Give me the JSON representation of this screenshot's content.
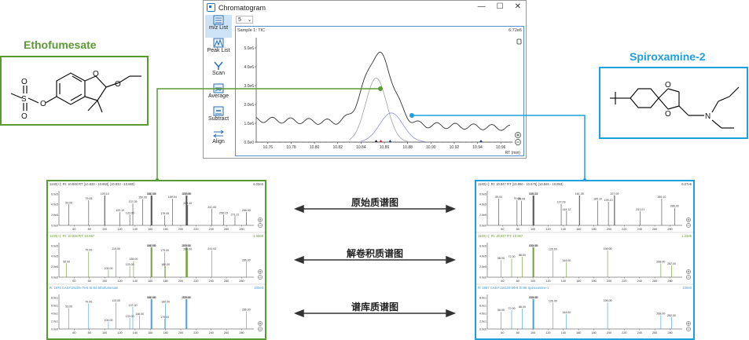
{
  "window": {
    "title": "Chromatogram",
    "controls": {
      "minimize": "—",
      "maximize": "☐",
      "close": "✕"
    },
    "selector_value": "5",
    "toolbar": [
      {
        "label": "m/z List",
        "icon": "mz-list-icon"
      },
      {
        "label": "Peak List",
        "icon": "peak-list-icon"
      },
      {
        "label": "Scan",
        "icon": "scan-icon"
      },
      {
        "label": "Average",
        "icon": "average-icon"
      },
      {
        "label": "Subtract",
        "icon": "subtract-icon"
      },
      {
        "label": "Align",
        "icon": "align-icon"
      }
    ],
    "plot_header_left": "Sample 1: TIC",
    "plot_header_right": "6.72e6",
    "xlabel": "RT (min)",
    "y_ticks": [
      "0.0e0",
      "1.0e6",
      "2.0e6",
      "3.0e6",
      "4.0e6",
      "5.0e6"
    ],
    "x_ticks": [
      "10.76",
      "10.78",
      "10.80",
      "10.82",
      "10.84",
      "10.86",
      "10.88",
      "10.90",
      "10.92",
      "10.94",
      "10.96"
    ]
  },
  "compounds": {
    "left_name": "Ethofumesate",
    "right_name": "Spiroxamine-2"
  },
  "labels": {
    "raw": "原始质谱图",
    "deconv": "解卷积质谱图",
    "library": "谱库质谱图"
  },
  "left_panels": [
    {
      "header": "1140(+): Rt: 10.848 RT [10.833 - 10.860] {10.833 - 10.860}",
      "max": "6.03e6",
      "color": "#444",
      "y_ticks": [
        "0.0e0",
        "2.0e5",
        "4.0e5",
        "6.0e5"
      ],
      "peaks": [
        [
          53.05,
          "53.05"
        ],
        [
          79.05,
          "79.05"
        ],
        [
          100.1,
          "100.10"
        ],
        [
          120.1,
          "120.10"
        ],
        [
          133.05,
          "133.05"
        ],
        [
          137.05,
          "137.05"
        ],
        [
          150.0,
          "150.00"
        ],
        [
          161.05,
          "161.05"
        ],
        [
          162.05,
          "162.05"
        ],
        [
          179.05,
          "179.05"
        ],
        [
          189.04,
          "189.04"
        ],
        [
          207.09,
          "207.09"
        ],
        [
          208.09,
          "208.09"
        ],
        [
          209.1,
          "209.10"
        ],
        [
          241.0,
          "241.00"
        ],
        [
          256.15,
          "256.15"
        ],
        [
          271.21,
          "271.21"
        ],
        [
          286.05,
          "286.05"
        ]
      ]
    },
    {
      "header": "1140(+): Rt: 10.848 RT: 10.867",
      "max": "1.63e6",
      "color": "#6a9a2f",
      "y_ticks": [
        "0.0e0",
        "2.0e5",
        "4.0e5",
        "6.0e5"
      ],
      "peaks": [
        [
          50.0,
          "50.00"
        ],
        [
          79.0,
          "79.00"
        ],
        [
          105.0,
          "105.00"
        ],
        [
          115.0,
          "115.00"
        ],
        [
          133.0,
          "133.00"
        ],
        [
          138.0,
          "138.00"
        ],
        [
          161.0,
          "161.00"
        ],
        [
          162.0,
          "162.00"
        ],
        [
          179.0,
          "179.00"
        ],
        [
          180.0,
          "180.00"
        ],
        [
          207.0,
          "207.00"
        ],
        [
          208.0,
          "208.00"
        ],
        [
          209.0,
          "209.00"
        ],
        [
          241.0,
          "241.00"
        ],
        [
          286.0,
          "286.00"
        ]
      ]
    },
    {
      "header": "R: 1976 CAS#:26225-79-6 SI:84 Ethofumesate",
      "max": "100e0",
      "color": "#3a9ad8",
      "y_ticks": [
        "0.0e0",
        "2.0e1",
        "4.0e1",
        "6.0e1",
        "8.0e1"
      ],
      "peaks": [
        [
          53.0,
          "53.00"
        ],
        [
          79.0,
          "79.00"
        ],
        [
          105.0,
          "105.00"
        ],
        [
          115.0,
          "115.00"
        ],
        [
          133.0,
          "133.00"
        ],
        [
          137.0,
          "137.00"
        ],
        [
          146.0,
          "146.00"
        ],
        [
          161.0,
          "161.00"
        ],
        [
          162.0,
          "162.00"
        ],
        [
          179.0,
          "179.00"
        ],
        [
          180.0,
          "180.00"
        ],
        [
          207.0,
          "207.00"
        ],
        [
          208.0,
          "208.00"
        ],
        [
          286.0,
          "286.00"
        ]
      ]
    }
  ],
  "right_panels": [
    {
      "header": "1140(+): Rt: 10.847 RT [10.860 - 10.875] {10.845 - 10.893}",
      "max": "6.07e6",
      "color": "#444",
      "y_ticks": [
        "0.0e0",
        "2.0e5",
        "4.0e5",
        "6.0e5"
      ],
      "peaks": [
        [
          55.04,
          "55.04"
        ],
        [
          79.05,
          "79.05"
        ],
        [
          85.06,
          "85.06"
        ],
        [
          100.1,
          "100.10"
        ],
        [
          101.12,
          "101.12"
        ],
        [
          137.09,
          "137.09"
        ],
        [
          144.12,
          "144.12"
        ],
        [
          161.05,
          "161.05"
        ],
        [
          185.1,
          "185.10"
        ],
        [
          199.1,
          "199.10"
        ],
        [
          207.09,
          "207.09"
        ],
        [
          241.01,
          "241.01"
        ],
        [
          269.1,
          "269.10"
        ],
        [
          286.0,
          "286.00"
        ]
      ]
    },
    {
      "header": "1140(+): Rt: 10.847 RT: 10.867",
      "max": "1.23e6",
      "color": "#6a9a2f",
      "y_ticks": [
        "0.0e0",
        "2.0e5",
        "4.0e5",
        "6.0e5"
      ],
      "peaks": [
        [
          58.0,
          "58.00"
        ],
        [
          72.0,
          "72.00"
        ],
        [
          86.0,
          "86.00"
        ],
        [
          100.0,
          "100.00"
        ],
        [
          101.0,
          "101.00"
        ],
        [
          126.0,
          "126.00"
        ],
        [
          144.0,
          "144.00"
        ],
        [
          198.0,
          "198.00"
        ],
        [
          268.0,
          "268.00"
        ],
        [
          282.0,
          "282.00"
        ]
      ]
    },
    {
      "header": "R: 1987 CAS#:118134-30-8 SI:86 Spiroxamine-1",
      "max": "100e0",
      "color": "#3a9ad8",
      "y_ticks": [
        "0.0e0",
        "2.0e1",
        "4.0e1",
        "6.0e1",
        "8.0e1"
      ],
      "peaks": [
        [
          58.0,
          "58.00"
        ],
        [
          72.0,
          "72.00"
        ],
        [
          86.0,
          "86.00"
        ],
        [
          100.0,
          "100.00"
        ],
        [
          101.0,
          "101.00"
        ],
        [
          126.0,
          "126.00"
        ],
        [
          144.0,
          "144.00"
        ],
        [
          198.0,
          "198.00"
        ],
        [
          268.0,
          "268.00"
        ],
        [
          282.0,
          "282.00"
        ]
      ]
    }
  ],
  "spec_x_ticks": [
    "60",
    "80",
    "100",
    "120",
    "140",
    "160",
    "180",
    "200",
    "220",
    "240",
    "260",
    "280"
  ],
  "colors": {
    "green": "#5a9a34",
    "blue": "#1ea0dc",
    "tic": "#333333",
    "grey": "#a0a0a0",
    "lavender": "#8e8ee8"
  }
}
